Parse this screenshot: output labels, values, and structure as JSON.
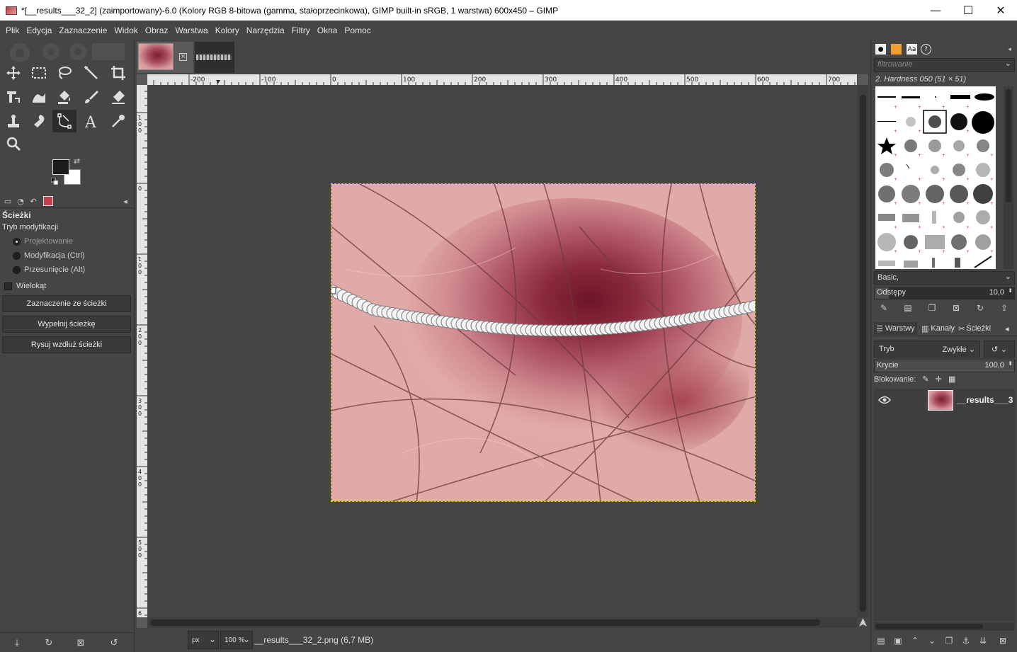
{
  "window": {
    "title": "*[__results___32_2] (zaimportowany)-6.0 (Kolory RGB 8-bitowa (gamma, stałoprzecinkowa), GIMP built-in sRGB, 1 warstwa) 600x450 – GIMP",
    "minimize": "—",
    "maximize": "☐",
    "close": "✕"
  },
  "menu": [
    "Plik",
    "Edycja",
    "Zaznaczenie",
    "Widok",
    "Obraz",
    "Warstwa",
    "Kolory",
    "Narzędzia",
    "Filtry",
    "Okna",
    "Pomoc"
  ],
  "colors": {
    "foreground": "#1c1c1c",
    "background": "#ffffff",
    "accent_selection": "#e8c400",
    "ui_background": "#454545"
  },
  "tool_options": {
    "title": "Ścieżki",
    "mode_label": "Tryb modyfikacji",
    "modes": [
      "Projektowanie",
      "Modyfikacja (Ctrl)",
      "Przesunięcie (Alt)"
    ],
    "selected_mode": "Projektowanie",
    "polygon_label": "Wielokąt",
    "polygon_checked": false,
    "buttons": {
      "selection_from_path": "Zaznaczenie ze ścieżki",
      "fill_path": "Wypełnij ścieżkę",
      "stroke_path": "Rysuj wzdłuż ścieżki"
    }
  },
  "ruler": {
    "h_labels": [
      "-200",
      "-100",
      "0",
      "100",
      "200",
      "300",
      "400",
      "500",
      "600",
      "700"
    ],
    "v_labels": [
      "100",
      "0",
      "100",
      "200",
      "300",
      "400",
      "500",
      "600"
    ]
  },
  "statusbar": {
    "unit": "px",
    "zoom": "100 %",
    "text": "__results___32_2.png (6,7 MB)"
  },
  "brushes": {
    "filter_placeholder": "filtrowanie",
    "selected_brush": "2. Hardness 050 (51 × 51)",
    "tag_filter": "Basic,",
    "spacing_label": "Odstępy",
    "spacing_value": "10,0",
    "spacing_fraction": 0.1
  },
  "layers": {
    "tabs": [
      "Warstwy",
      "Kanały",
      "Ścieżki"
    ],
    "mode_label": "Tryb",
    "mode_value": "Zwykłe",
    "opacity_label": "Krycie",
    "opacity_value": "100,0",
    "opacity_fraction": 1.0,
    "lock_label": "Blokowanie:",
    "items": [
      {
        "name": "__results___3",
        "visible": true
      }
    ]
  }
}
